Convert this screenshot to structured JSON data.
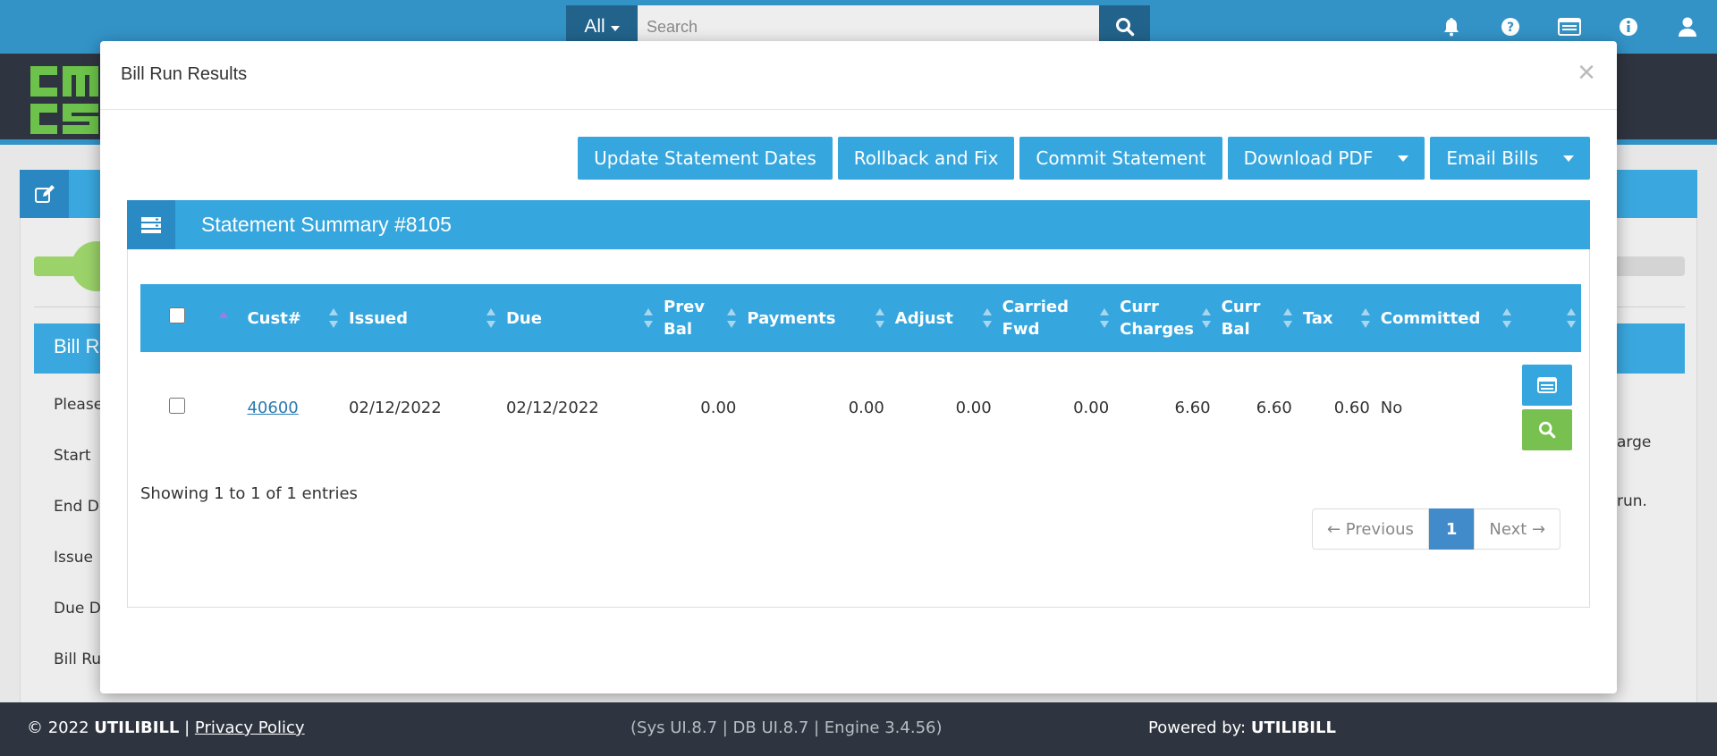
{
  "topbar": {
    "search_scope": "All",
    "search_placeholder": "Search",
    "icons": [
      "bell-icon",
      "question-icon",
      "list-card-icon",
      "info-icon",
      "user-icon"
    ]
  },
  "background": {
    "section_title": "Bill R",
    "labels": [
      "Please",
      "Start",
      "End D",
      "Issue",
      "Due D",
      "Bill Ru"
    ],
    "right_text_1": "arge",
    "right_text_2": "run."
  },
  "modal": {
    "title": "Bill Run Results",
    "close": "×",
    "buttons": {
      "update_dates": "Update Statement Dates",
      "rollback": "Rollback and Fix",
      "commit": "Commit Statement",
      "download_pdf": "Download PDF",
      "email_bills": "Email Bills"
    },
    "summary_title": "Statement Summary #8105",
    "table": {
      "columns": [
        "Cust#",
        "Issued",
        "Due",
        "Prev Bal",
        "Payments",
        "Adjust",
        "Carried Fwd",
        "Curr Charges",
        "Curr Bal",
        "Tax",
        "Committed"
      ],
      "rows": [
        {
          "cust": "40600",
          "issued": "02/12/2022",
          "due": "02/12/2022",
          "prev_bal": "0.00",
          "payments": "0.00",
          "adjust": "0.00",
          "carried_fwd": "0.00",
          "curr_charges": "6.60",
          "curr_bal": "6.60",
          "tax": "0.60",
          "committed": "No"
        }
      ]
    },
    "showing": "Showing 1 to 1 of 1 entries",
    "pager": {
      "prev": "← Previous",
      "current": "1",
      "next": "Next →"
    }
  },
  "footer": {
    "copyright": "© 2022 ",
    "brand": "UTILIBILL",
    "separator": " | ",
    "privacy": "Privacy Policy",
    "versions": "(Sys UI.8.7 | DB UI.8.7 | Engine 3.4.56)",
    "powered_label": "Powered by: ",
    "powered_brand": "UTILIBILL"
  },
  "colors": {
    "accent": "#36a6de",
    "topbar": "#3393c7",
    "dark": "#2f3540",
    "green": "#78c04f",
    "pager_active": "#428bca"
  }
}
